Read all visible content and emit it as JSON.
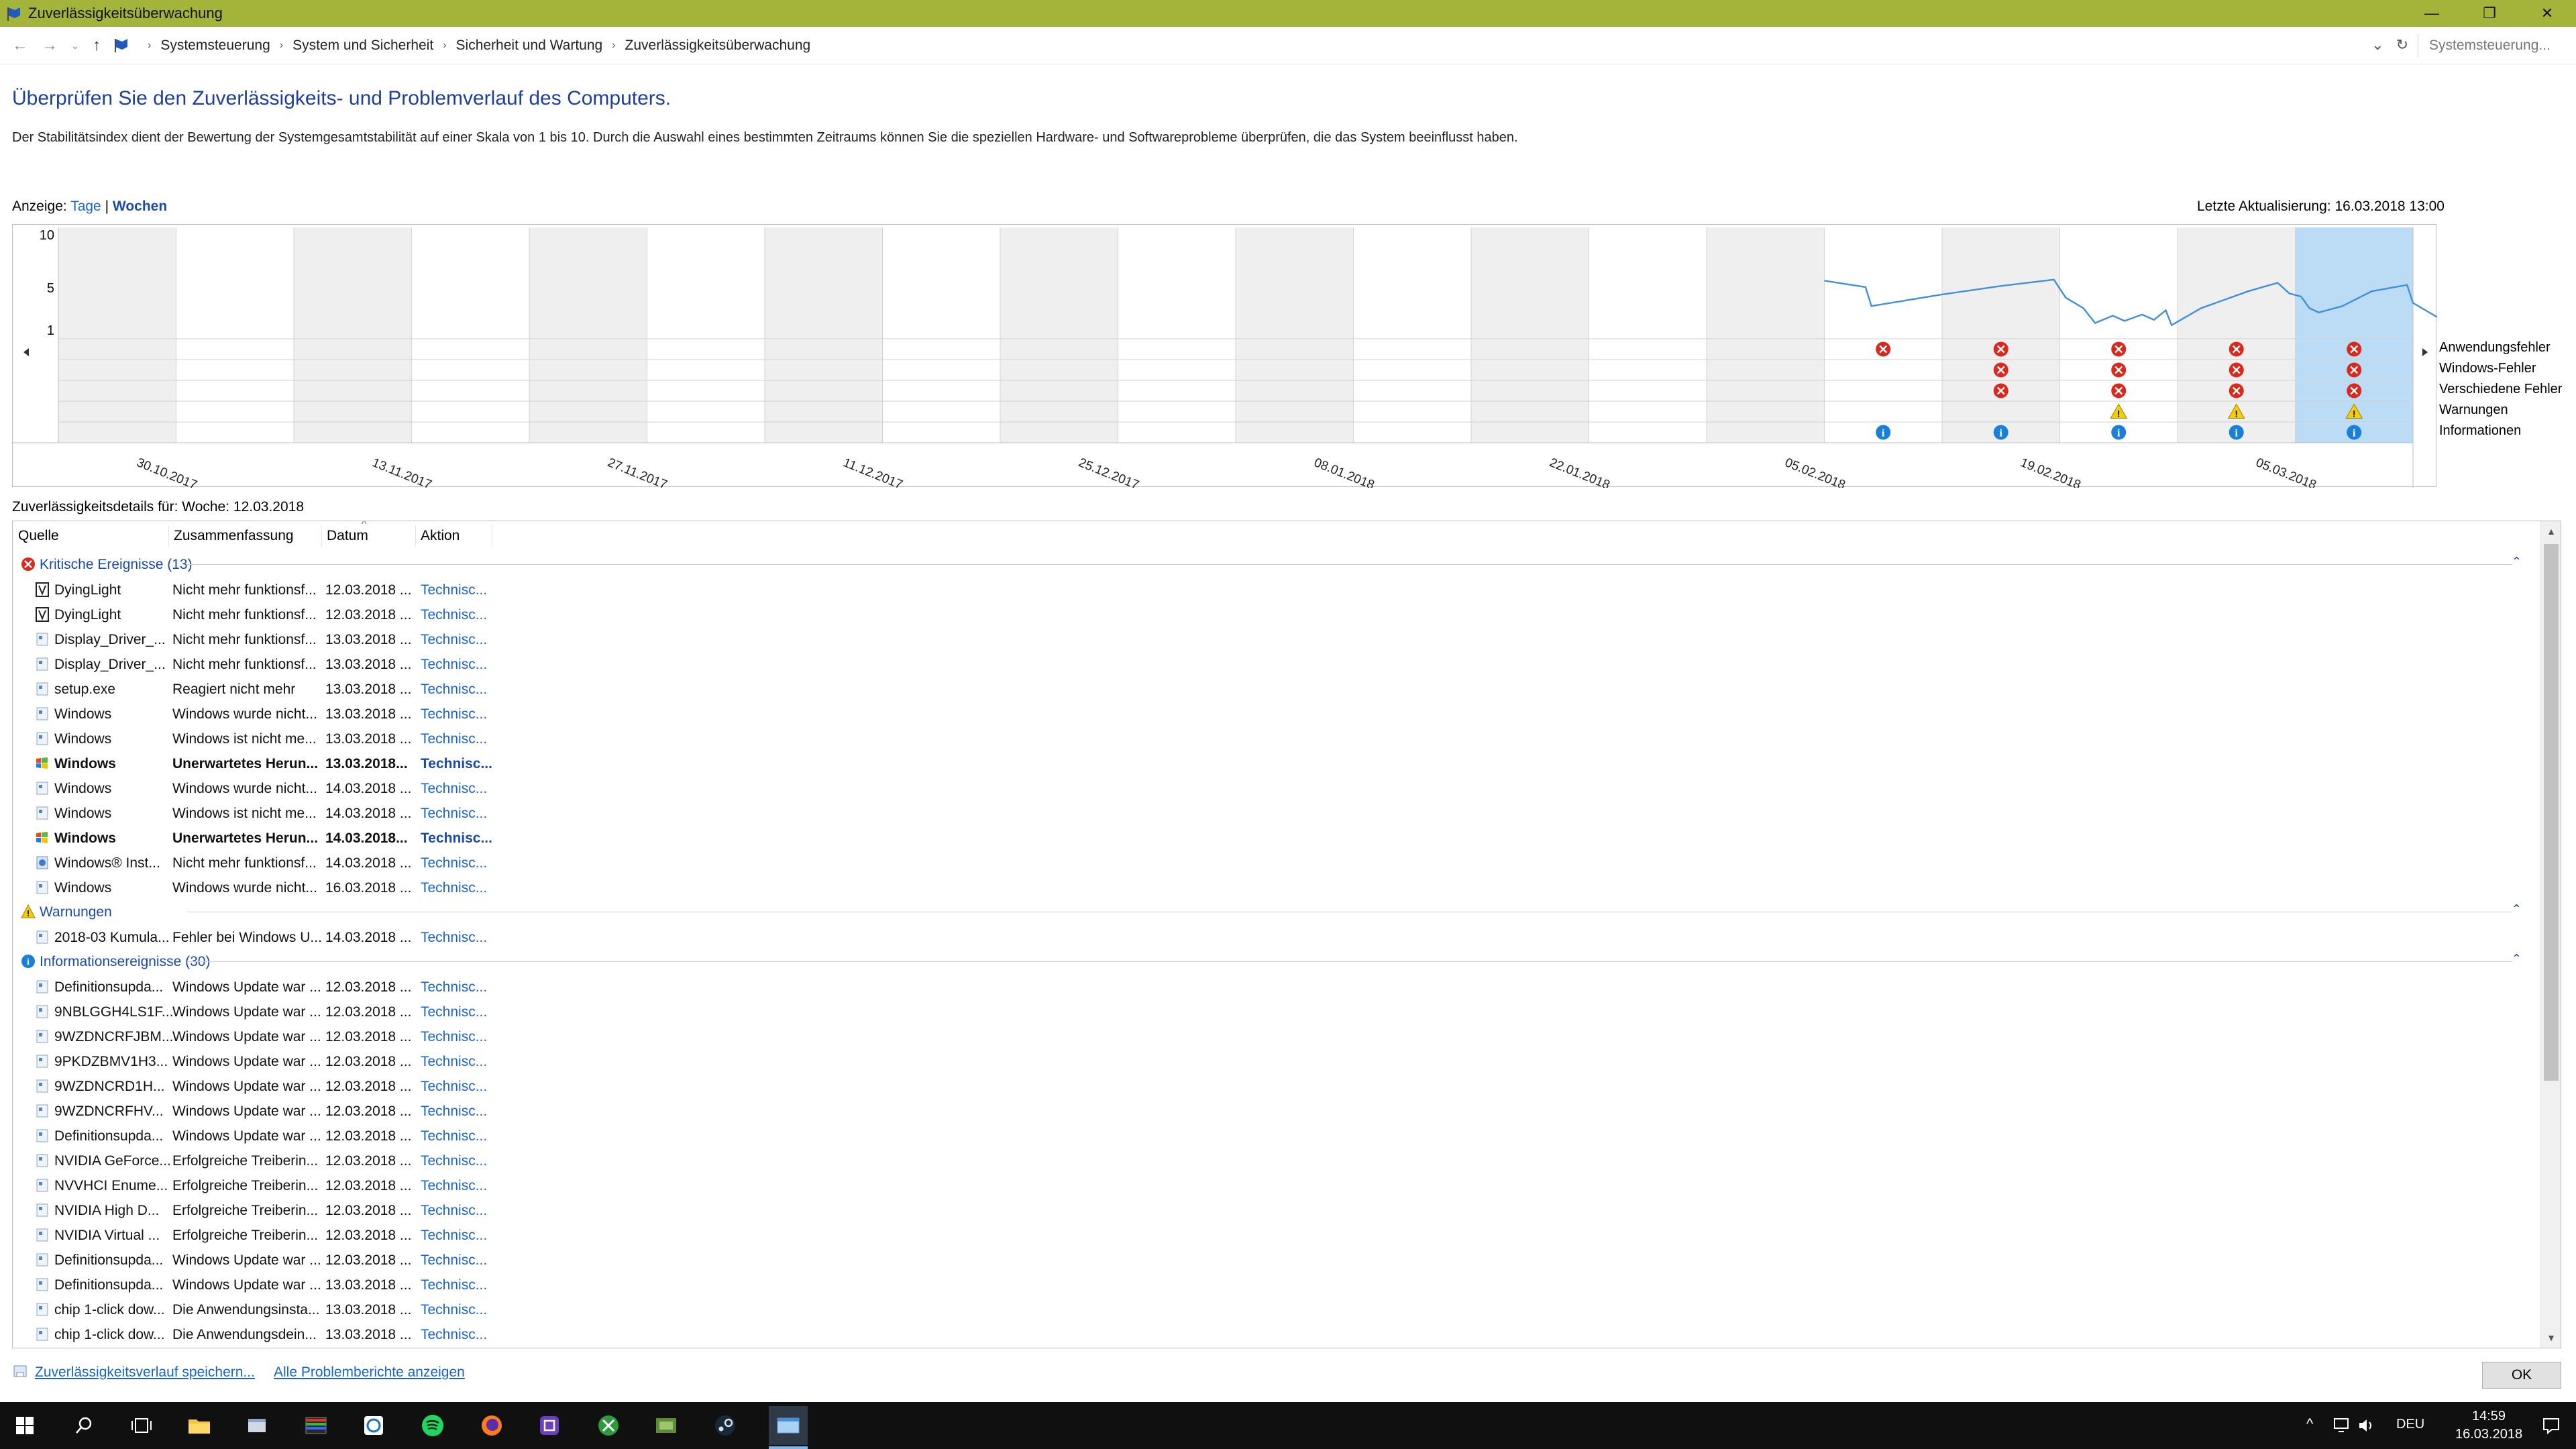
{
  "window": {
    "title": "Zuverlässigkeitsüberwachung",
    "accent": "#a4b43a"
  },
  "breadcrumbs": [
    "Systemsteuerung",
    "System und Sicherheit",
    "Sicherheit und Wartung",
    "Zuverlässigkeitsüberwachung"
  ],
  "search": {
    "placeholder": "Systemsteuerung..."
  },
  "page": {
    "heading": "Überprüfen Sie den Zuverlässigkeits- und Problemverlauf des Computers.",
    "intro": "Der Stabilitätsindex dient der Bewertung der Systemgesamtstabilität auf einer Skala von 1 bis 10. Durch die Auswahl eines bestimmten Zeitraums können Sie die speziellen Hardware- und Softwareprobleme überprüfen, die das System beeinflusst haben.",
    "view_label": "Anzeige:",
    "view_days": "Tage",
    "view_sep": "|",
    "view_weeks": "Wochen",
    "last_update": "Letzte Aktualisierung: 16.03.2018 13:00",
    "details_caption": "Zuverlässigkeitsdetails für: Woche: 12.03.2018"
  },
  "chart_data": {
    "type": "line",
    "title": "",
    "ylim": [
      1,
      10
    ],
    "yticks": [
      "10",
      "5",
      "1"
    ],
    "x_labels": [
      "30.10.2017",
      "13.11.2017",
      "27.11.2017",
      "11.12.2017",
      "25.12.2017",
      "08.01.2018",
      "22.01.2018",
      "05.02.2018",
      "19.02.2018",
      "05.03.2018"
    ],
    "columns": 20,
    "selected_column": 19,
    "stability_series": {
      "name": "Stabilitätsindex",
      "start_column": 15,
      "points": [
        [
          15.0,
          5.6
        ],
        [
          15.35,
          5.0
        ],
        [
          15.4,
          3.2
        ],
        [
          16.0,
          4.3
        ],
        [
          16.5,
          5.1
        ],
        [
          16.95,
          5.7
        ],
        [
          17.05,
          4.0
        ],
        [
          17.2,
          3.0
        ],
        [
          17.3,
          1.6
        ],
        [
          17.45,
          2.3
        ],
        [
          17.55,
          1.8
        ],
        [
          17.7,
          2.4
        ],
        [
          17.8,
          1.9
        ],
        [
          17.9,
          2.8
        ],
        [
          17.95,
          1.4
        ],
        [
          18.2,
          3.0
        ],
        [
          18.6,
          4.6
        ],
        [
          18.85,
          5.4
        ],
        [
          18.95,
          4.4
        ],
        [
          19.05,
          4.1
        ],
        [
          19.12,
          3.0
        ],
        [
          19.2,
          2.6
        ],
        [
          19.4,
          3.2
        ],
        [
          19.65,
          4.6
        ],
        [
          19.95,
          5.2
        ],
        [
          20.0,
          3.5
        ],
        [
          20.2,
          2.2
        ],
        [
          20.4,
          3.2
        ],
        [
          20.8,
          4.8
        ],
        [
          21.0,
          5.9
        ],
        [
          21.25,
          6.6
        ],
        [
          21.35,
          4.7
        ],
        [
          21.5,
          2.2
        ],
        [
          21.6,
          3.5
        ],
        [
          21.8,
          2.4
        ],
        [
          22.0,
          3.0
        ]
      ]
    },
    "row_labels": [
      "Anwendungsfehler",
      "Windows-Fehler",
      "Verschiedene Fehler",
      "Warnungen",
      "Informationen"
    ],
    "events": {
      "Anwendungsfehler": [
        15,
        16,
        17,
        18,
        19
      ],
      "Windows-Fehler": [
        16,
        17,
        18,
        19
      ],
      "Verschiedene Fehler": [
        16,
        17,
        18,
        19
      ],
      "Warnungen": [
        17,
        18,
        19
      ],
      "Informationen": [
        15,
        16,
        17,
        18,
        19
      ]
    },
    "colors": {
      "line": "#3f8fdc",
      "error": "#d9291c",
      "warning": "#f5d000",
      "info": "#1a7fd6",
      "selected": "#bcdbf5",
      "shaded": "#efefef"
    }
  },
  "table": {
    "columns": [
      "Quelle",
      "Zusammenfassung",
      "Datum",
      "Aktion"
    ],
    "groups": [
      {
        "type": "error",
        "label": "Kritische Ereignisse (13)",
        "rows": [
          {
            "icon": "game-icon",
            "source": "DyingLight",
            "summary": "Nicht mehr funktionsf...",
            "date": "12.03.2018 ...",
            "action": "Technisc...",
            "bold": false
          },
          {
            "icon": "game-icon",
            "source": "DyingLight",
            "summary": "Nicht mehr funktionsf...",
            "date": "12.03.2018 ...",
            "action": "Technisc...",
            "bold": false
          },
          {
            "icon": "app-icon",
            "source": "Display_Driver_...",
            "summary": "Nicht mehr funktionsf...",
            "date": "13.03.2018 ...",
            "action": "Technisc...",
            "bold": false
          },
          {
            "icon": "app-icon",
            "source": "Display_Driver_...",
            "summary": "Nicht mehr funktionsf...",
            "date": "13.03.2018 ...",
            "action": "Technisc...",
            "bold": false
          },
          {
            "icon": "app-icon",
            "source": "setup.exe",
            "summary": "Reagiert nicht mehr",
            "date": "13.03.2018 ...",
            "action": "Technisc...",
            "bold": false
          },
          {
            "icon": "app-icon",
            "source": "Windows",
            "summary": "Windows wurde nicht...",
            "date": "13.03.2018 ...",
            "action": "Technisc...",
            "bold": false
          },
          {
            "icon": "app-icon",
            "source": "Windows",
            "summary": "Windows ist nicht me...",
            "date": "13.03.2018 ...",
            "action": "Technisc...",
            "bold": false
          },
          {
            "icon": "windows-flag-icon",
            "source": "Windows",
            "summary": "Unerwartetes Herun...",
            "date": "13.03.2018...",
            "action": "Technisc...",
            "bold": true
          },
          {
            "icon": "app-icon",
            "source": "Windows",
            "summary": "Windows wurde nicht...",
            "date": "14.03.2018 ...",
            "action": "Technisc...",
            "bold": false
          },
          {
            "icon": "app-icon",
            "source": "Windows",
            "summary": "Windows ist nicht me...",
            "date": "14.03.2018 ...",
            "action": "Technisc...",
            "bold": false
          },
          {
            "icon": "windows-flag-icon",
            "source": "Windows",
            "summary": "Unerwartetes Herun...",
            "date": "14.03.2018...",
            "action": "Technisc...",
            "bold": true
          },
          {
            "icon": "installer-icon",
            "source": "Windows® Inst...",
            "summary": "Nicht mehr funktionsf...",
            "date": "14.03.2018 ...",
            "action": "Technisc...",
            "bold": false
          },
          {
            "icon": "app-icon",
            "source": "Windows",
            "summary": "Windows wurde nicht...",
            "date": "16.03.2018 ...",
            "action": "Technisc...",
            "bold": false
          }
        ]
      },
      {
        "type": "warning",
        "label": "Warnungen",
        "rows": [
          {
            "icon": "app-icon",
            "source": "2018-03 Kumula...",
            "summary": "Fehler bei Windows U...",
            "date": "14.03.2018 ...",
            "action": "Technisc...",
            "bold": false
          }
        ]
      },
      {
        "type": "info",
        "label": "Informationsereignisse (30)",
        "rows": [
          {
            "icon": "app-icon",
            "source": "Definitionsupda...",
            "summary": "Windows Update war ...",
            "date": "12.03.2018 ...",
            "action": "Technisc...",
            "bold": false
          },
          {
            "icon": "app-icon",
            "source": "9NBLGGH4LS1F...",
            "summary": "Windows Update war ...",
            "date": "12.03.2018 ...",
            "action": "Technisc...",
            "bold": false
          },
          {
            "icon": "app-icon",
            "source": "9WZDNCRFJBM...",
            "summary": "Windows Update war ...",
            "date": "12.03.2018 ...",
            "action": "Technisc...",
            "bold": false
          },
          {
            "icon": "app-icon",
            "source": "9PKDZBMV1H3...",
            "summary": "Windows Update war ...",
            "date": "12.03.2018 ...",
            "action": "Technisc...",
            "bold": false
          },
          {
            "icon": "app-icon",
            "source": "9WZDNCRD1H...",
            "summary": "Windows Update war ...",
            "date": "12.03.2018 ...",
            "action": "Technisc...",
            "bold": false
          },
          {
            "icon": "app-icon",
            "source": "9WZDNCRFHV...",
            "summary": "Windows Update war ...",
            "date": "12.03.2018 ...",
            "action": "Technisc...",
            "bold": false
          },
          {
            "icon": "app-icon",
            "source": "Definitionsupda...",
            "summary": "Windows Update war ...",
            "date": "12.03.2018 ...",
            "action": "Technisc...",
            "bold": false
          },
          {
            "icon": "app-icon",
            "source": "NVIDIA GeForce...",
            "summary": "Erfolgreiche Treiberin...",
            "date": "12.03.2018 ...",
            "action": "Technisc...",
            "bold": false
          },
          {
            "icon": "app-icon",
            "source": "NVVHCI Enume...",
            "summary": "Erfolgreiche Treiberin...",
            "date": "12.03.2018 ...",
            "action": "Technisc...",
            "bold": false
          },
          {
            "icon": "app-icon",
            "source": "NVIDIA High D...",
            "summary": "Erfolgreiche Treiberin...",
            "date": "12.03.2018 ...",
            "action": "Technisc...",
            "bold": false
          },
          {
            "icon": "app-icon",
            "source": "NVIDIA Virtual ...",
            "summary": "Erfolgreiche Treiberin...",
            "date": "12.03.2018 ...",
            "action": "Technisc...",
            "bold": false
          },
          {
            "icon": "app-icon",
            "source": "Definitionsupda...",
            "summary": "Windows Update war ...",
            "date": "12.03.2018 ...",
            "action": "Technisc...",
            "bold": false
          },
          {
            "icon": "app-icon",
            "source": "Definitionsupda...",
            "summary": "Windows Update war ...",
            "date": "13.03.2018 ...",
            "action": "Technisc...",
            "bold": false
          },
          {
            "icon": "app-icon",
            "source": "chip 1-click dow...",
            "summary": "Die Anwendungsinsta...",
            "date": "13.03.2018 ...",
            "action": "Technisc...",
            "bold": false
          },
          {
            "icon": "app-icon",
            "source": "chip 1-click dow...",
            "summary": "Die Anwendungsdein...",
            "date": "13.03.2018 ...",
            "action": "Technisc...",
            "bold": false
          }
        ]
      }
    ]
  },
  "footer": {
    "save_link": "Zuverlässigkeitsverlauf speichern...",
    "all_reports_link": "Alle Problemberichte anzeigen",
    "ok_label": "OK"
  },
  "taskbar": {
    "time": "14:59",
    "date": "16.03.2018",
    "language": "DEU"
  }
}
